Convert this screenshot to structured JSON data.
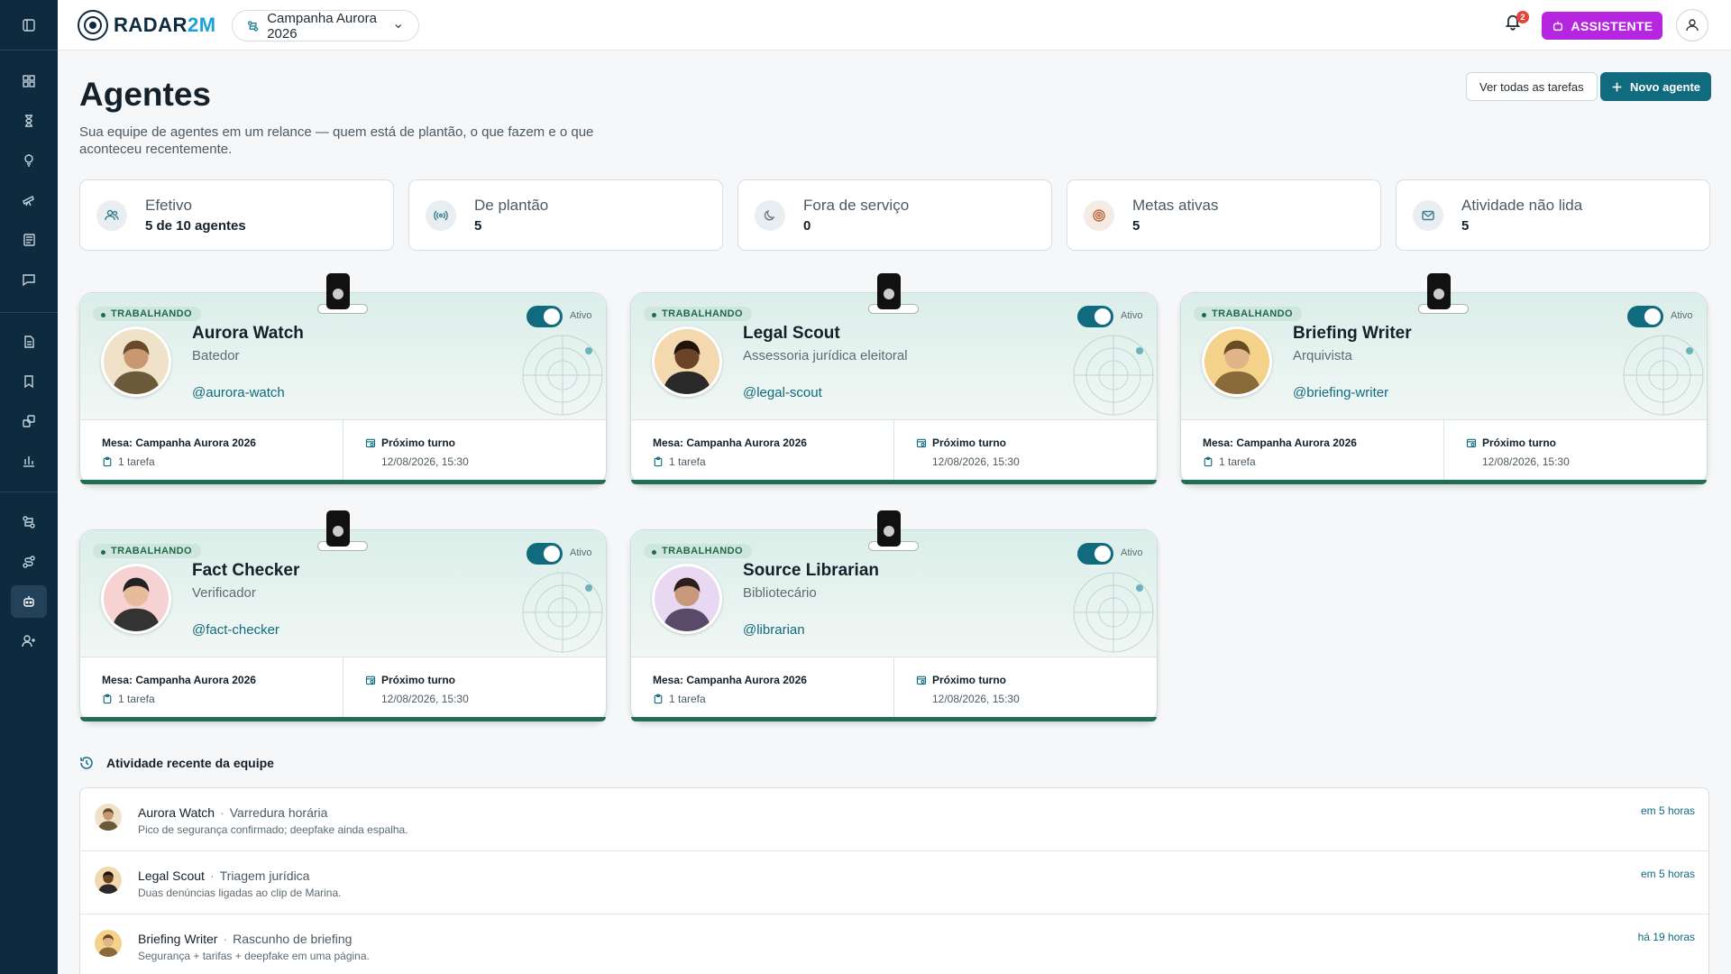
{
  "app": {
    "logo_main": "RADAR",
    "logo_accent": "2M",
    "campaign": "Campanha Aurora 2026",
    "notifications": "2",
    "assistant": "ASSISTENTE"
  },
  "page": {
    "title": "Agentes",
    "subtitle": "Sua equipe de agentes em um relance — quem está de plantão, o que fazem e o que aconteceu recentemente.",
    "view_all": "Ver todas as tarefas",
    "new_agent": "Novo agente"
  },
  "stats": [
    {
      "label": "Efetivo",
      "value": "5 de 10 agentes",
      "icon": "users-icon"
    },
    {
      "label": "De plantão",
      "value": "5",
      "icon": "broadcast-icon"
    },
    {
      "label": "Fora de serviço",
      "value": "0",
      "icon": "moon-icon"
    },
    {
      "label": "Metas ativas",
      "value": "5",
      "icon": "target-icon"
    },
    {
      "label": "Atividade não lida",
      "value": "5",
      "icon": "mail-icon"
    }
  ],
  "agents": [
    {
      "status": "TRABALHANDO",
      "name": "Aurora Watch",
      "role": "Batedor",
      "handle": "@aurora-watch",
      "toggle": "Ativo",
      "desk": "Mesa: Campanha Aurora 2026",
      "tasks": "1 tarefa",
      "next_label": "Próximo turno",
      "next_value": "12/08/2026, 15:30"
    },
    {
      "status": "TRABALHANDO",
      "name": "Legal Scout",
      "role": "Assessoria jurídica eleitoral",
      "handle": "@legal-scout",
      "toggle": "Ativo",
      "desk": "Mesa: Campanha Aurora 2026",
      "tasks": "1 tarefa",
      "next_label": "Próximo turno",
      "next_value": "12/08/2026, 15:30"
    },
    {
      "status": "TRABALHANDO",
      "name": "Briefing Writer",
      "role": "Arquivista",
      "handle": "@briefing-writer",
      "toggle": "Ativo",
      "desk": "Mesa: Campanha Aurora 2026",
      "tasks": "1 tarefa",
      "next_label": "Próximo turno",
      "next_value": "12/08/2026, 15:30"
    },
    {
      "status": "TRABALHANDO",
      "name": "Fact Checker",
      "role": "Verificador",
      "handle": "@fact-checker",
      "toggle": "Ativo",
      "desk": "Mesa: Campanha Aurora 2026",
      "tasks": "1 tarefa",
      "next_label": "Próximo turno",
      "next_value": "12/08/2026, 15:30"
    },
    {
      "status": "TRABALHANDO",
      "name": "Source Librarian",
      "role": "Bibliotecário",
      "handle": "@librarian",
      "toggle": "Ativo",
      "desk": "Mesa: Campanha Aurora 2026",
      "tasks": "1 tarefa",
      "next_label": "Próximo turno",
      "next_value": "12/08/2026, 15:30"
    }
  ],
  "activity": {
    "title": "Atividade recente da equipe",
    "items": [
      {
        "agent": "Aurora Watch",
        "task": "Varredura horária",
        "detail": "Pico de segurança confirmado; deepfake ainda espalha.",
        "time": "em 5 horas"
      },
      {
        "agent": "Legal Scout",
        "task": "Triagem jurídica",
        "detail": "Duas denúncias ligadas ao clip de Marina.",
        "time": "em 5 horas"
      },
      {
        "agent": "Briefing Writer",
        "task": "Rascunho de briefing",
        "detail": "Segurança + tarifas + deepfake em uma página.",
        "time": "há 19 horas"
      }
    ]
  },
  "colors": {
    "sidebar": "#0e2a3f",
    "accent": "#0f6b7d",
    "assistant": "#b625e0",
    "status": "#1e6a4c"
  }
}
